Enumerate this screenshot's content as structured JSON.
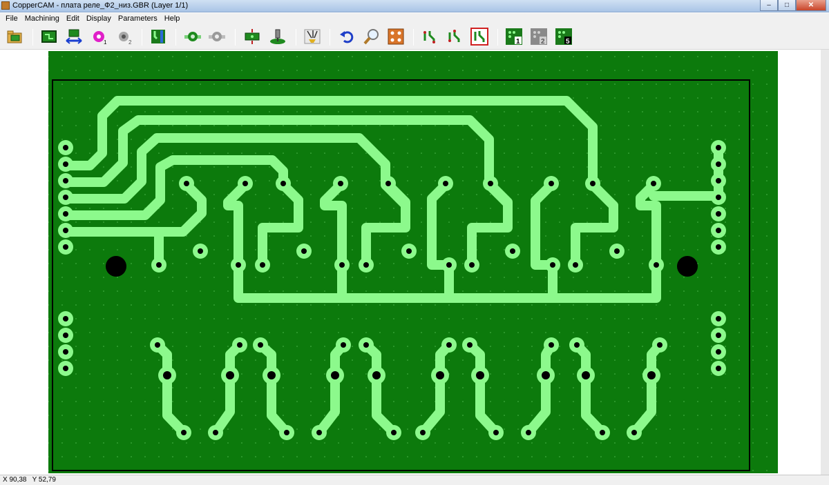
{
  "window": {
    "title": "CopperCAM  -  плата реле_Ф2_низ.GBR  (Layer 1/1)",
    "minimize_glyph": "–",
    "maximize_glyph": "□",
    "close_glyph": "✕"
  },
  "menu": {
    "items": [
      "File",
      "Machining",
      "Edit",
      "Display",
      "Parameters",
      "Help"
    ]
  },
  "toolbar": {
    "tools": [
      {
        "icon": "open-folder-icon"
      },
      {
        "icon": "board-outline-icon"
      },
      {
        "icon": "resize-arrows-icon"
      },
      {
        "icon": "pad-drill-1-icon",
        "badge": "1"
      },
      {
        "icon": "pad-drill-2-icon",
        "badge": "2"
      },
      {
        "icon": "track-icon"
      },
      {
        "icon": "pad-round-icon"
      },
      {
        "icon": "pad-oblong-icon"
      },
      {
        "icon": "contour-icon"
      },
      {
        "icon": "tool-icon"
      },
      {
        "icon": "laser-icon"
      },
      {
        "icon": "undo-icon"
      },
      {
        "icon": "zoom-icon"
      },
      {
        "icon": "drill-plate-icon"
      },
      {
        "icon": "path-icon"
      },
      {
        "icon": "path-alt-icon"
      },
      {
        "icon": "path-selected-icon"
      },
      {
        "icon": "layer-1-icon",
        "badge": "1"
      },
      {
        "icon": "layer-2-icon",
        "badge": "2"
      },
      {
        "icon": "layer-5-icon",
        "badge": "5"
      }
    ]
  },
  "status": {
    "coordinates": "X 90,38   Y 52,79"
  },
  "colors": {
    "board": "#0c7a0c",
    "copper": "#8cf98c",
    "hole": "#000000",
    "outline": "#000000"
  }
}
